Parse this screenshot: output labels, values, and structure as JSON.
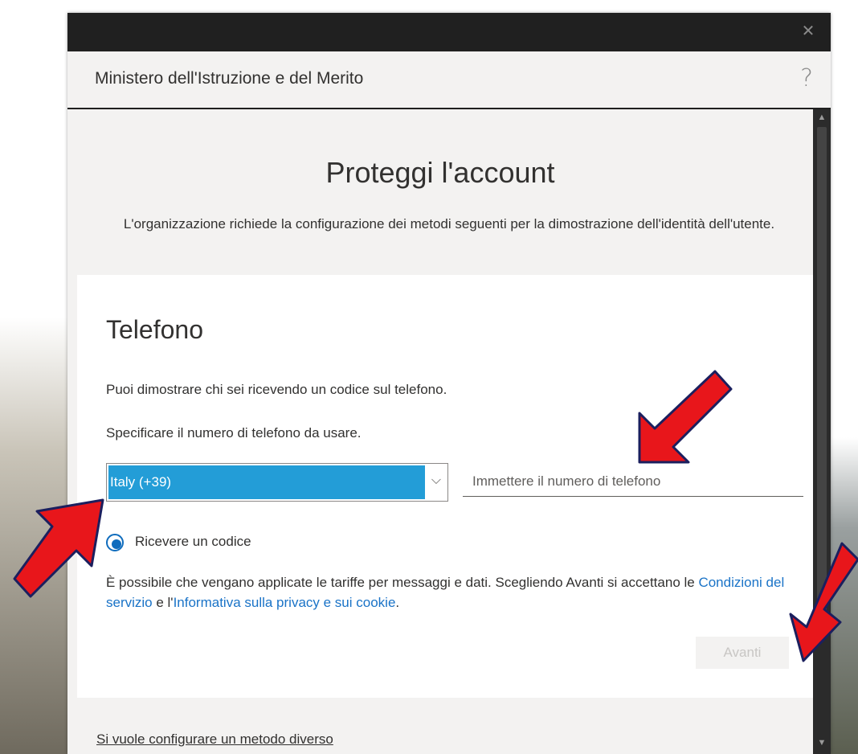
{
  "window": {
    "close_icon": "close-icon"
  },
  "header": {
    "org_name": "Ministero dell'Istruzione e del Merito",
    "help_label": "?"
  },
  "page": {
    "title": "Proteggi l'account",
    "subtitle": "L'organizzazione richiede la configurazione dei metodi seguenti per la dimostrazione dell'identità dell'utente."
  },
  "card": {
    "title": "Telefono",
    "intro": "Puoi dimostrare chi sei ricevendo un codice sul telefono.",
    "spec": "Specificare il numero di telefono da usare.",
    "country_value": "Italy (+39)",
    "phone_placeholder": "Immettere il numero di telefono",
    "radio_label": "Ricevere un codice",
    "disclaimer_prefix": "È possibile che vengano applicate le tariffe per messaggi e dati. Scegliendo Avanti si accettano le ",
    "terms_link": "Condizioni del servizio",
    "disclaimer_middle": " e l'",
    "privacy_link": "Informativa sulla privacy e sui cookie",
    "disclaimer_suffix": ".",
    "next_label": "Avanti"
  },
  "footer": {
    "alt_method": "Si vuole configurare un metodo diverso"
  },
  "colors": {
    "titlebar": "#202020",
    "selected_country_bg": "#239dd7",
    "link": "#1a73c7",
    "radio": "#0f6cbd",
    "annotation_arrow": "#e8161b"
  }
}
